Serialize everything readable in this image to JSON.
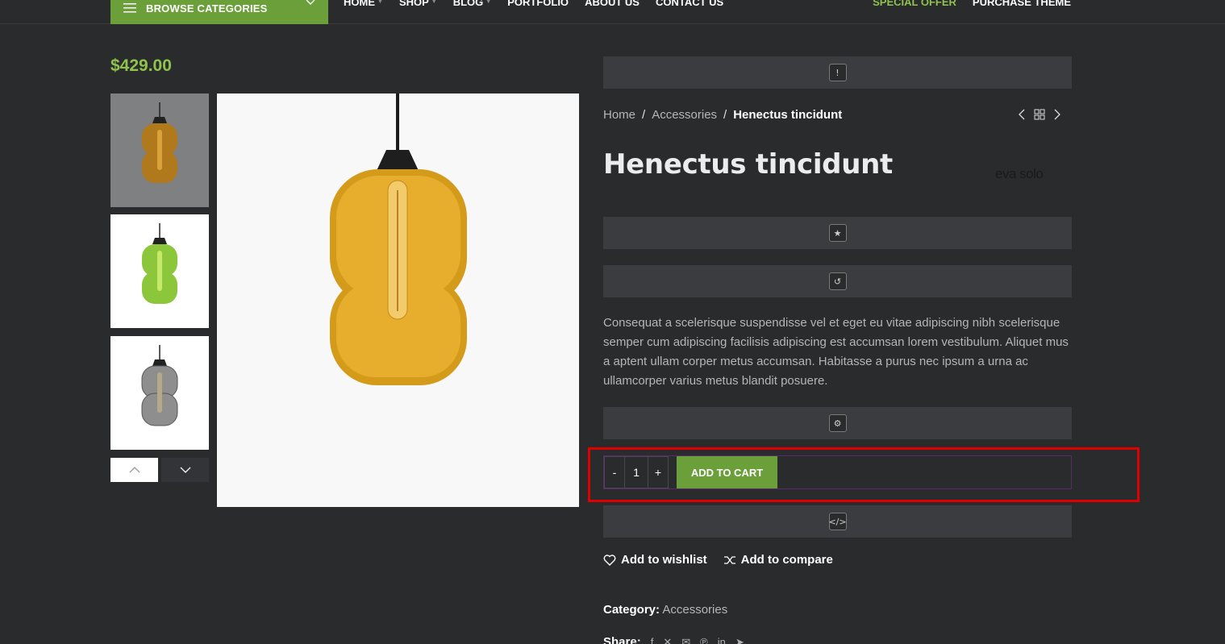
{
  "header": {
    "browse_label": "BROWSE CATEGORIES",
    "nav": [
      "HOME",
      "SHOP",
      "BLOG",
      "PORTFOLIO",
      "ABOUT US",
      "CONTACT US"
    ],
    "right_links": [
      "SPECIAL OFFER",
      "PURCHASE THEME"
    ]
  },
  "product": {
    "price": "$429.00",
    "title": "Henectus tincidunt",
    "brand_logo": "eva solo",
    "description": "Consequat a scelerisque suspendisse vel et eget eu vitae adipiscing nibh scelerisque semper cum adipiscing facilisis adipiscing est accumsan lorem vestibulum. Aliquet mus a aptent ullam corper metus accumsan. Habitasse a purus nec ipsum a urna ac ullamcorper varius metus blandit posuere."
  },
  "breadcrumb": {
    "items": [
      "Home",
      "Accessories",
      "Henectus tincidunt"
    ],
    "separator": "/"
  },
  "cart": {
    "minus_label": "-",
    "quantity": "1",
    "plus_label": "+",
    "add_label": "ADD TO CART"
  },
  "actions": {
    "wishlist": "Add to wishlist",
    "compare": "Add to compare"
  },
  "meta": {
    "category_key": "Category:",
    "category_value": "Accessories",
    "share_label": "Share:"
  },
  "colors": {
    "accent": "#6a9f3a",
    "price": "#8fc34e",
    "background": "#2a2b2d"
  }
}
